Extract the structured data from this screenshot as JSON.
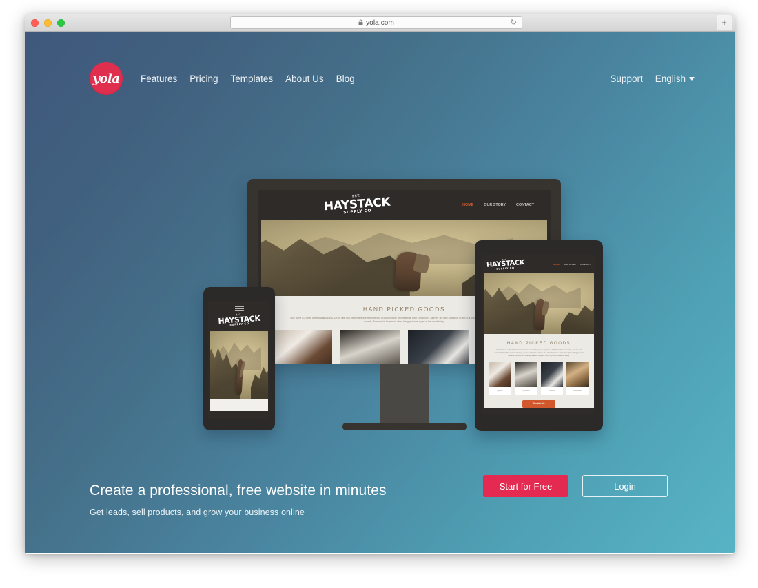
{
  "browser": {
    "url": "yola.com",
    "lock_icon": "lock-icon",
    "reload_icon": "reload-icon",
    "new_tab_label": "+",
    "traffic_lights": [
      "close",
      "minimize",
      "maximize"
    ]
  },
  "site": {
    "logo_text": "yola",
    "nav": [
      {
        "label": "Features"
      },
      {
        "label": "Pricing"
      },
      {
        "label": "Templates"
      },
      {
        "label": "About Us"
      },
      {
        "label": "Blog"
      }
    ],
    "support_label": "Support",
    "language_label": "English"
  },
  "hero": {
    "headline": "Create a professional, free website in minutes",
    "subheadline": "Get leads, sell products, and grow your business online",
    "primary_cta": "Start for Free",
    "secondary_cta": "Login"
  },
  "mockup": {
    "brand_pre": "EST.",
    "brand": "HAYSTACK",
    "brand_sub": "SUPPLY CO",
    "nav": [
      {
        "label": "HOME",
        "active": true
      },
      {
        "label": "OUR STORY",
        "active": false
      },
      {
        "label": "CONTACT",
        "active": false
      }
    ],
    "section_title": "HAND PICKED GOODS",
    "section_paragraph": "Your home is a three dimensional canvas. Let us help you experiment with the right mix of color, texture and materials from Tomorrow's Journey, our new collection of one-of-a-kind finds from around the globe. Rugged and durable, Tomorrow's Journey is about bringing home a part of the world today.",
    "products": [
      {
        "caption": "Apparel"
      },
      {
        "caption": "Household"
      },
      {
        "caption": "Outdoor"
      },
      {
        "caption": "Accessories"
      }
    ],
    "contact_button": "Contact Us"
  },
  "colors": {
    "brand_red": "#e02e4e",
    "cta_red": "#e42a50",
    "gradient_start": "#3f587c",
    "gradient_end": "#57b4c5",
    "mockup_accent": "#d0582c"
  }
}
